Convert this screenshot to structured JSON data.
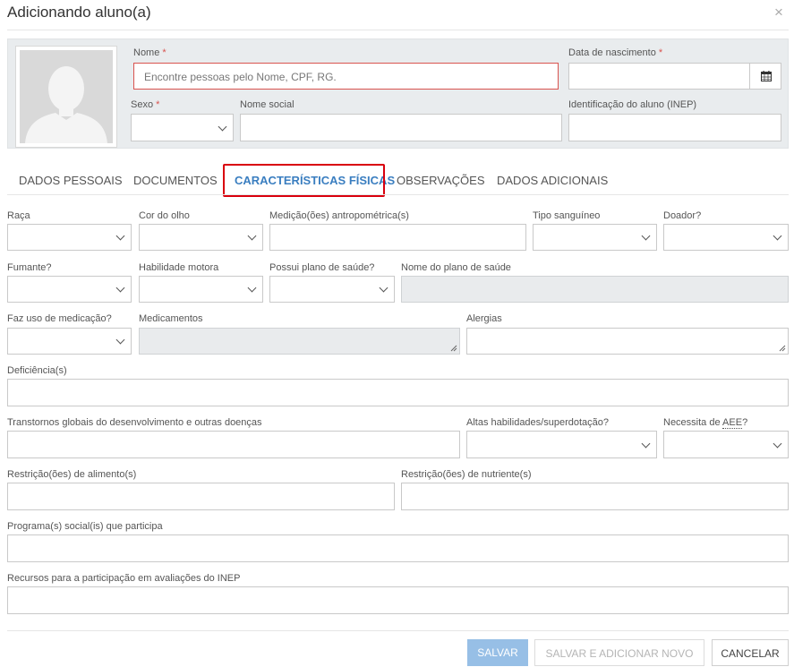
{
  "dialog": {
    "title": "Adicionando aluno(a)",
    "close_icon": "×"
  },
  "header": {
    "nome_label": "Nome",
    "nome_placeholder": "Encontre pessoas pelo Nome, CPF, RG.",
    "data_nascimento_label": "Data de nascimento",
    "sexo_label": "Sexo",
    "nome_social_label": "Nome social",
    "inep_label": "Identificação do aluno (INEP)",
    "required_mark": "*"
  },
  "tabs": [
    {
      "label": "DADOS PESSOAIS",
      "active": false
    },
    {
      "label": "DOCUMENTOS",
      "active": false
    },
    {
      "label": "CARACTERÍSTICAS FÍSICAS",
      "active": true
    },
    {
      "label": "OBSERVAÇÕES",
      "active": false
    },
    {
      "label": "DADOS ADICIONAIS",
      "active": false
    }
  ],
  "fields": {
    "raca": "Raça",
    "cor_olho": "Cor do olho",
    "medicoes": "Medição(ões) antropométrica(s)",
    "tipo_sanguineo": "Tipo sanguíneo",
    "doador": "Doador?",
    "fumante": "Fumante?",
    "habilidade_motora": "Habilidade motora",
    "plano_saude": "Possui plano de saúde?",
    "nome_plano": "Nome do plano de saúde",
    "uso_medicacao": "Faz uso de medicação?",
    "medicamentos": "Medicamentos",
    "alergias": "Alergias",
    "deficiencias": "Deficiência(s)",
    "transtornos": "Transtornos globais do desenvolvimento e outras doenças",
    "altas_habilidades": "Altas habilidades/superdotação?",
    "necessita_aee_prefix": "Necessita de ",
    "necessita_aee_abbr": "AEE",
    "necessita_aee_suffix": "?",
    "restricao_alimento": "Restrição(ões) de alimento(s)",
    "restricao_nutriente": "Restrição(ões) de nutriente(s)",
    "programas_sociais": "Programa(s) social(is) que participa",
    "recursos_inep": "Recursos para a participação em avaliações do INEP"
  },
  "footer": {
    "save_label": "SALVAR",
    "save_add_label": "SALVAR E ADICIONAR NOVO",
    "cancel_label": "CANCELAR"
  },
  "icons": {
    "avatar": "avatar-placeholder",
    "calendar": "calendar-icon",
    "chevron": "chevron-down-icon"
  },
  "colors": {
    "accent": "#3a7ec0",
    "required": "#d9534f",
    "tab_highlight": "#d9000d",
    "primary_button": "#97bfe6"
  }
}
